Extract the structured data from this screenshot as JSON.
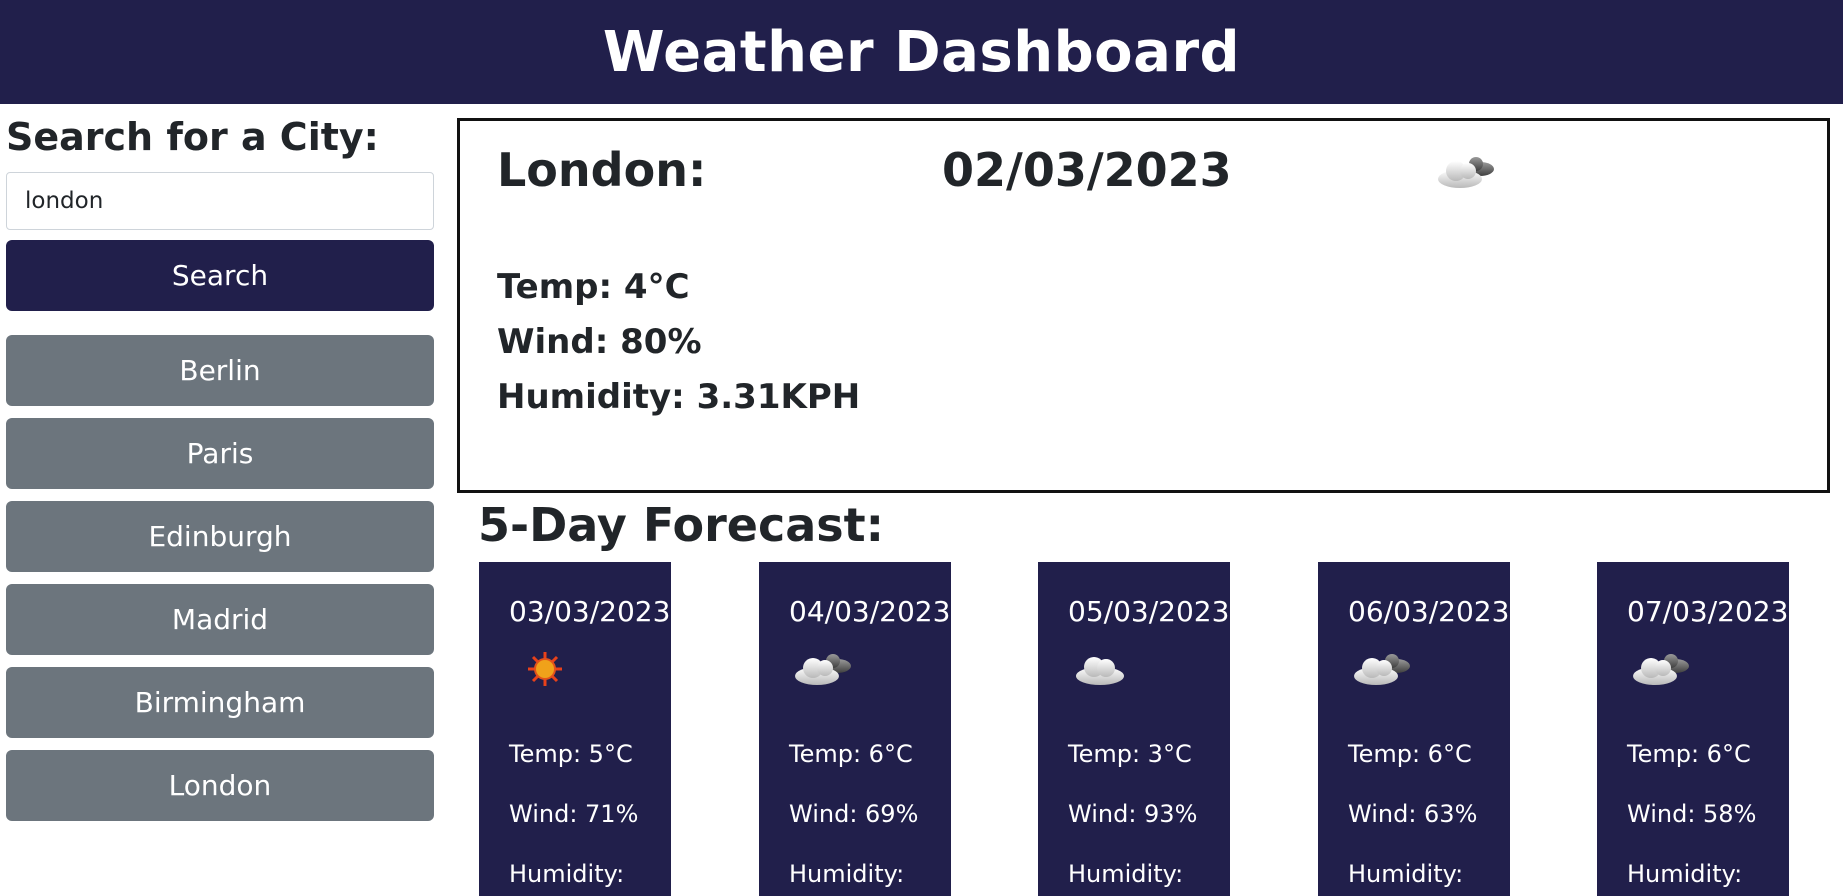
{
  "header": {
    "title": "Weather Dashboard"
  },
  "search": {
    "heading": "Search for a City:",
    "value": "london",
    "button_label": "Search"
  },
  "history": [
    "Berlin",
    "Paris",
    "Edinburgh",
    "Madrid",
    "Birmingham",
    "London"
  ],
  "current": {
    "city": "London:",
    "date": "02/03/2023",
    "icon": "partly-cloudy-icon",
    "temp": "Temp: 4°C",
    "wind": "Wind: 80%",
    "humidity": "Humidity: 3.31KPH"
  },
  "forecast": {
    "title": "5-Day Forecast:",
    "days": [
      {
        "date": "03/03/2023",
        "icon": "sun-icon",
        "temp": "Temp: 5°C",
        "wind": "Wind: 71%",
        "humidity": "Humidity:"
      },
      {
        "date": "04/03/2023",
        "icon": "partly-cloudy-icon",
        "temp": "Temp: 6°C",
        "wind": "Wind: 69%",
        "humidity": "Humidity:"
      },
      {
        "date": "05/03/2023",
        "icon": "cloud-icon",
        "temp": "Temp: 3°C",
        "wind": "Wind: 93%",
        "humidity": "Humidity:"
      },
      {
        "date": "06/03/2023",
        "icon": "partly-cloudy-icon",
        "temp": "Temp: 6°C",
        "wind": "Wind: 63%",
        "humidity": "Humidity:"
      },
      {
        "date": "07/03/2023",
        "icon": "partly-cloudy-icon",
        "temp": "Temp: 6°C",
        "wind": "Wind: 58%",
        "humidity": "Humidity:"
      }
    ]
  },
  "colors": {
    "primary": "#211f4b",
    "history_button": "#6c757d",
    "text": "#212529"
  }
}
